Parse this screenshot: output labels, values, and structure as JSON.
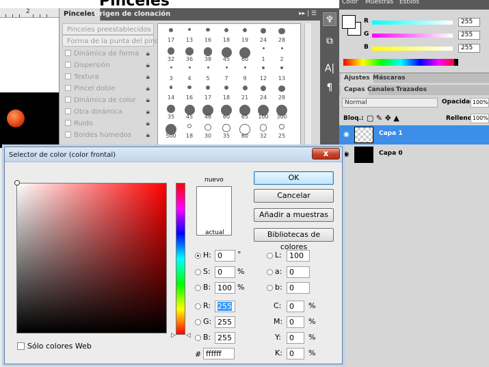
{
  "top": {
    "title": "Pinceles"
  },
  "ruler": {
    "mark": "2"
  },
  "brushes_panel": {
    "tab_active": "Pinceles",
    "tab_other": "Origen de clonación",
    "controls": "▸▸ | ☰",
    "options": [
      "Pinceles preestablecidos",
      "Forma de la punta del pincel",
      "Dinámica de forma",
      "Dispersión",
      "Textura",
      "Pincel doble",
      "Dinámica de color",
      "Otra dinámica",
      "Ruido",
      "Bordes húmedos"
    ],
    "preset_numbers": [
      [
        "17",
        "13",
        "16",
        "18",
        "19",
        "24",
        "28"
      ],
      [
        "32",
        "36",
        "38",
        "45",
        "60",
        "1",
        "2"
      ],
      [
        "3",
        "4",
        "5",
        "7",
        "9",
        "12",
        "13"
      ],
      [
        "14",
        "16",
        "17",
        "18",
        "21",
        "24",
        "28"
      ],
      [
        "35",
        "45",
        "48",
        "60",
        "65",
        "100",
        "300"
      ],
      [
        "500",
        "18",
        "30",
        "35",
        "60",
        "32",
        "25"
      ]
    ]
  },
  "right": {
    "color_tabs": [
      "Color",
      "Muestras",
      "Estilos"
    ],
    "sliders": [
      {
        "label": "R",
        "value": "255",
        "gradient": "linear-gradient(to right, #0ff, #fff)"
      },
      {
        "label": "G",
        "value": "255",
        "gradient": "linear-gradient(to right, #f0f, #fff)"
      },
      {
        "label": "B",
        "value": "255",
        "gradient": "linear-gradient(to right, #ff0, #fff)"
      }
    ],
    "adj_tabs": [
      "Ajustes",
      "Máscaras"
    ],
    "layer_tabs": [
      "Capas",
      "Canales",
      "Trazados"
    ],
    "blend_mode": "Normal",
    "opacity_label": "Opacidad:",
    "opacity_value": "100%",
    "lock_label": "Bloq.:",
    "fill_label": "Relleno:",
    "fill_value": "100%",
    "layers": [
      "Capa 1",
      "Capa 0"
    ],
    "selected_color": "#3d8ee8"
  },
  "dialog": {
    "title": "Selector de color (color frontal)",
    "close": "x",
    "nuevo": "nuevo",
    "actual": "actual",
    "buttons": {
      "ok": "OK",
      "cancel": "Cancelar",
      "add": "Añadir a muestras",
      "libraries": "Bibliotecas de colores"
    },
    "fields": {
      "h_label": "H:",
      "h_value": "0",
      "h_unit": "°",
      "s_label": "S:",
      "s_value": "0",
      "s_unit": "%",
      "b_label": "B:",
      "b_value": "100",
      "b_unit": "%",
      "r_label": "R:",
      "r_value": "255",
      "g_label": "G:",
      "g_value": "255",
      "bb_label": "B:",
      "bb_value": "255",
      "l_label": "L:",
      "l_value": "100",
      "a_label": "a:",
      "a_value": "0",
      "blab_label": "b:",
      "blab_value": "0",
      "c_label": "C:",
      "c_value": "0",
      "c_unit": "%",
      "m_label": "M:",
      "m_value": "0",
      "m_unit": "%",
      "y_label": "Y:",
      "y_value": "0",
      "y_unit": "%",
      "k_label": "K:",
      "k_value": "0",
      "k_unit": "%",
      "hex_label": "#",
      "hex_value": "ffffff"
    },
    "web_only": "Sólo colores Web"
  }
}
